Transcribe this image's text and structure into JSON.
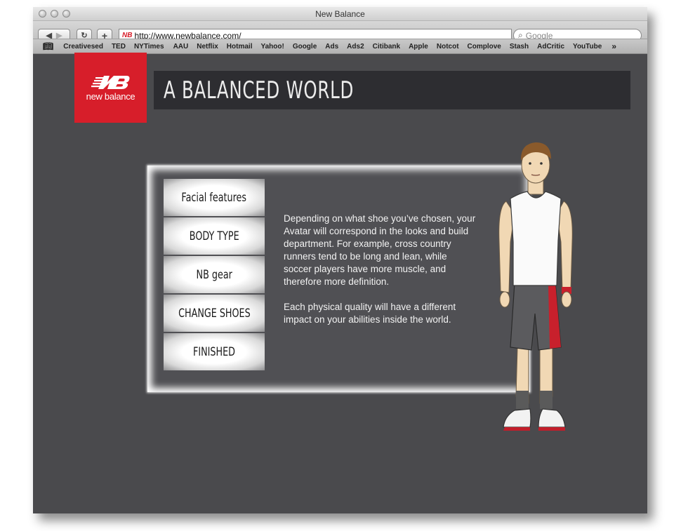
{
  "browser": {
    "title": "New Balance",
    "url": "http://www.newbalance.com/",
    "search_placeholder": "Google",
    "bookmarks": [
      "Creativesed",
      "TED",
      "NYTimes",
      "AAU",
      "Netflix",
      "Hotmail",
      "Yahoo!",
      "Google",
      "Ads",
      "Ads2",
      "Citibank",
      "Apple",
      "Notcot",
      "Complove",
      "Stash",
      "AdCritic",
      "YouTube"
    ]
  },
  "brand": {
    "name": "new balance",
    "color": "#d71e2a"
  },
  "page": {
    "title": "A BALANCED WORLD"
  },
  "menu": {
    "items": [
      "Facial features",
      "BODY TYPE",
      "NB gear",
      "CHANGE SHOES",
      "FINISHED"
    ]
  },
  "description": {
    "paragraph1": "Depending on what shoe you’ve chosen, your Avatar will correspond in the looks and build department. For example, cross country runners tend to be long and lean, while soccer players have more muscle, and therefore more definition.",
    "paragraph2": "Each physical quality will have a different impact on your abilities inside the world."
  }
}
